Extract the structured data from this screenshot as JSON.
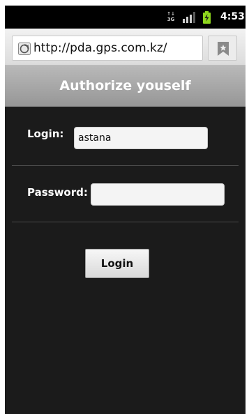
{
  "status_bar": {
    "network_type": "3G",
    "time": "4:53"
  },
  "browser": {
    "url": "http://pda.gps.com.kz/",
    "icons": {
      "site": "globe-icon",
      "bookmark": "bookmark-icon"
    }
  },
  "page": {
    "title": "Authorize youself",
    "login_label": "Login:",
    "login_value": "astana",
    "password_label": "Password:",
    "password_value": "",
    "login_button": "Login"
  },
  "colors": {
    "background": "#1b1b1b",
    "header": "#a8a8a8",
    "battery": "#8ed61d"
  }
}
